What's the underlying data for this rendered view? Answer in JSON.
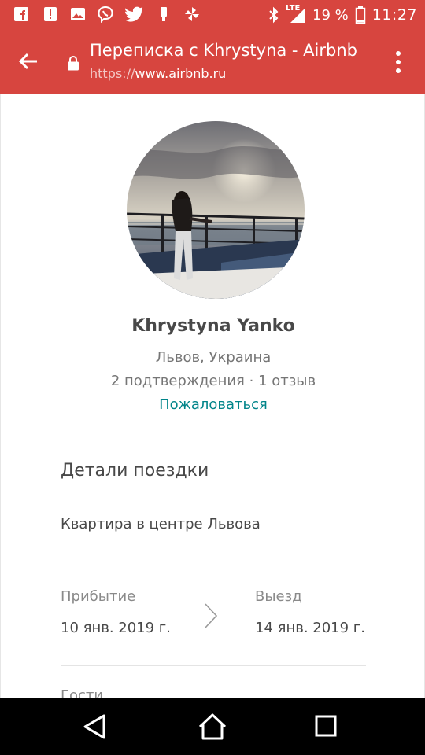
{
  "status_bar": {
    "network": "LTE",
    "battery": "19 %",
    "time": "11:27"
  },
  "toolbar": {
    "title": "Переписка с Khrystyna - Airbnb",
    "url_scheme": "https://",
    "url_host": "www.airbnb.ru"
  },
  "profile": {
    "name": "Khrystyna Yanko",
    "location": "Львов, Украина",
    "stats": "2 подтверждения · 1 отзыв",
    "report_link": "Пожаловаться"
  },
  "trip": {
    "section_title": "Детали поездки",
    "listing": "Квартира в центре Львова",
    "checkin_label": "Прибытие",
    "checkin_value": "10 янв. 2019 г.",
    "checkout_label": "Выезд",
    "checkout_value": "14 янв. 2019 г.",
    "guests_label": "Гости"
  },
  "colors": {
    "brand_bar": "#d7453f",
    "link": "#008489"
  },
  "icons": [
    "facebook-icon",
    "notification-icon",
    "gallery-icon",
    "viber-icon",
    "twitter-icon",
    "device-icon",
    "pinwheel-icon",
    "bluetooth-icon",
    "signal-icon",
    "battery-icon",
    "back-arrow-icon",
    "lock-icon",
    "overflow-menu-icon",
    "chevron-right-icon",
    "nav-back-icon",
    "nav-home-icon",
    "nav-recents-icon"
  ]
}
